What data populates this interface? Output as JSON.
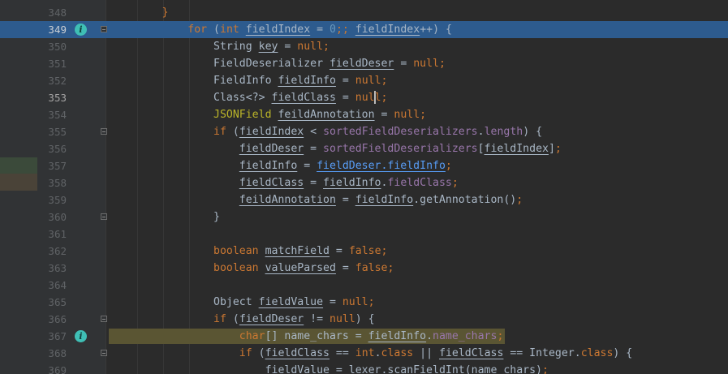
{
  "colors": {
    "kw": "#cc7832",
    "plain": "#a9b7c6",
    "field": "#9876aa",
    "num": "#6897bb",
    "method": "#ffc66d",
    "anno": "#bbb529",
    "link": "#589df6",
    "strip_green": "#3b4a3a",
    "strip_brown": "#4a4338"
  },
  "editor": {
    "lines": [
      {
        "n": "348",
        "segs": [
          {
            "t": "        ",
            "c": "plain"
          },
          {
            "t": "}",
            "c": "kw"
          }
        ]
      },
      {
        "n": "349",
        "info": true,
        "fold": true,
        "blue": true,
        "segs": [
          {
            "t": "            ",
            "c": "plain"
          },
          {
            "t": "for ",
            "c": "kw"
          },
          {
            "t": "(",
            "c": "plain"
          },
          {
            "t": "int ",
            "c": "kw"
          },
          {
            "t": "fieldIndex",
            "c": "plain",
            "u": true
          },
          {
            "t": " = ",
            "c": "plain"
          },
          {
            "t": "0",
            "c": "num"
          },
          {
            "t": ";; ",
            "c": "kw"
          },
          {
            "t": "fieldIndex",
            "c": "plain",
            "u": true
          },
          {
            "t": "++) {",
            "c": "plain"
          }
        ]
      },
      {
        "n": "350",
        "segs": [
          {
            "t": "                ",
            "c": "plain"
          },
          {
            "t": "String ",
            "c": "plain"
          },
          {
            "t": "key",
            "c": "plain",
            "u": true
          },
          {
            "t": " = ",
            "c": "plain"
          },
          {
            "t": "null",
            "c": "kw"
          },
          {
            "t": ";",
            "c": "kw"
          }
        ]
      },
      {
        "n": "351",
        "segs": [
          {
            "t": "                ",
            "c": "plain"
          },
          {
            "t": "FieldDeserializer ",
            "c": "plain"
          },
          {
            "t": "fieldDeser",
            "c": "plain",
            "u": true
          },
          {
            "t": " = ",
            "c": "plain"
          },
          {
            "t": "null",
            "c": "kw"
          },
          {
            "t": ";",
            "c": "kw"
          }
        ]
      },
      {
        "n": "352",
        "segs": [
          {
            "t": "                ",
            "c": "plain"
          },
          {
            "t": "FieldInfo ",
            "c": "plain"
          },
          {
            "t": "fieldInfo",
            "c": "plain",
            "u": true
          },
          {
            "t": " = ",
            "c": "plain"
          },
          {
            "t": "null",
            "c": "kw"
          },
          {
            "t": ";",
            "c": "kw"
          }
        ]
      },
      {
        "n": "353",
        "current": true,
        "segs": [
          {
            "t": "                ",
            "c": "plain"
          },
          {
            "t": "Class<?> ",
            "c": "plain"
          },
          {
            "t": "fieldClass",
            "c": "plain",
            "u": true
          },
          {
            "t": " = ",
            "c": "plain"
          },
          {
            "t": "nul",
            "c": "kw"
          },
          {
            "caret": true
          },
          {
            "t": "l",
            "c": "kw"
          },
          {
            "t": ";",
            "c": "kw"
          }
        ]
      },
      {
        "n": "354",
        "segs": [
          {
            "t": "                ",
            "c": "plain"
          },
          {
            "t": "JSONField ",
            "c": "anno"
          },
          {
            "t": "feildAnnotation",
            "c": "plain",
            "u": true
          },
          {
            "t": " = ",
            "c": "plain"
          },
          {
            "t": "null",
            "c": "kw"
          },
          {
            "t": ";",
            "c": "kw"
          }
        ]
      },
      {
        "n": "355",
        "fold": true,
        "segs": [
          {
            "t": "                ",
            "c": "plain"
          },
          {
            "t": "if ",
            "c": "kw"
          },
          {
            "t": "(",
            "c": "plain"
          },
          {
            "t": "fieldIndex",
            "c": "plain",
            "u": true
          },
          {
            "t": " < ",
            "c": "plain"
          },
          {
            "t": "sortedFieldDeserializers",
            "c": "field"
          },
          {
            "t": ".",
            "c": "plain"
          },
          {
            "t": "length",
            "c": "field"
          },
          {
            "t": ") {",
            "c": "plain"
          }
        ]
      },
      {
        "n": "356",
        "segs": [
          {
            "t": "                    ",
            "c": "plain"
          },
          {
            "t": "fieldDeser",
            "c": "plain",
            "u": true
          },
          {
            "t": " = ",
            "c": "plain"
          },
          {
            "t": "sortedFieldDeserializers",
            "c": "field"
          },
          {
            "t": "[",
            "c": "plain"
          },
          {
            "t": "fieldIndex",
            "c": "plain",
            "u": true
          },
          {
            "t": "]",
            "c": "plain"
          },
          {
            "t": ";",
            "c": "kw"
          }
        ]
      },
      {
        "n": "357",
        "segs": [
          {
            "t": "                    ",
            "c": "plain"
          },
          {
            "t": "fieldInfo",
            "c": "plain",
            "u": true
          },
          {
            "t": " = ",
            "c": "plain"
          },
          {
            "t": "fieldDeser.fieldInfo",
            "c": "link",
            "u": true
          },
          {
            "t": ";",
            "c": "kw"
          }
        ]
      },
      {
        "n": "358",
        "segs": [
          {
            "t": "                    ",
            "c": "plain"
          },
          {
            "t": "fieldClass",
            "c": "plain",
            "u": true
          },
          {
            "t": " = ",
            "c": "plain"
          },
          {
            "t": "fieldInfo",
            "c": "plain",
            "u": true
          },
          {
            "t": ".",
            "c": "plain"
          },
          {
            "t": "fieldClass",
            "c": "field"
          },
          {
            "t": ";",
            "c": "kw"
          }
        ]
      },
      {
        "n": "359",
        "segs": [
          {
            "t": "                    ",
            "c": "plain"
          },
          {
            "t": "feildAnnotation",
            "c": "plain",
            "u": true
          },
          {
            "t": " = ",
            "c": "plain"
          },
          {
            "t": "fieldInfo",
            "c": "plain",
            "u": true
          },
          {
            "t": ".getAnnotation()",
            "c": "plain"
          },
          {
            "t": ";",
            "c": "kw"
          }
        ]
      },
      {
        "n": "360",
        "fold": true,
        "segs": [
          {
            "t": "                ",
            "c": "plain"
          },
          {
            "t": "}",
            "c": "plain"
          }
        ]
      },
      {
        "n": "361",
        "segs": []
      },
      {
        "n": "362",
        "segs": [
          {
            "t": "                ",
            "c": "plain"
          },
          {
            "t": "boolean ",
            "c": "kw"
          },
          {
            "t": "matchField",
            "c": "plain",
            "u": true
          },
          {
            "t": " = ",
            "c": "plain"
          },
          {
            "t": "false",
            "c": "kw"
          },
          {
            "t": ";",
            "c": "kw"
          }
        ]
      },
      {
        "n": "363",
        "segs": [
          {
            "t": "                ",
            "c": "plain"
          },
          {
            "t": "boolean ",
            "c": "kw"
          },
          {
            "t": "valueParsed",
            "c": "plain",
            "u": true
          },
          {
            "t": " = ",
            "c": "plain"
          },
          {
            "t": "false",
            "c": "kw"
          },
          {
            "t": ";",
            "c": "kw"
          }
        ]
      },
      {
        "n": "364",
        "segs": []
      },
      {
        "n": "365",
        "segs": [
          {
            "t": "                ",
            "c": "plain"
          },
          {
            "t": "Object ",
            "c": "plain"
          },
          {
            "t": "fieldValue",
            "c": "plain",
            "u": true
          },
          {
            "t": " = ",
            "c": "plain"
          },
          {
            "t": "null",
            "c": "kw"
          },
          {
            "t": ";",
            "c": "kw"
          }
        ]
      },
      {
        "n": "366",
        "fold": true,
        "segs": [
          {
            "t": "                ",
            "c": "plain"
          },
          {
            "t": "if ",
            "c": "kw"
          },
          {
            "t": "(",
            "c": "plain"
          },
          {
            "t": "fieldDeser",
            "c": "plain",
            "u": true
          },
          {
            "t": " != ",
            "c": "plain"
          },
          {
            "t": "null",
            "c": "kw"
          },
          {
            "t": ") {",
            "c": "plain"
          }
        ]
      },
      {
        "n": "367",
        "info": true,
        "bp": true,
        "segs": [
          {
            "t": "                    ",
            "c": "plain"
          },
          {
            "t": "char",
            "c": "kw"
          },
          {
            "t": "[] name_chars = ",
            "c": "plain"
          },
          {
            "t": "fieldInfo",
            "c": "plain",
            "u": true
          },
          {
            "t": ".",
            "c": "plain"
          },
          {
            "t": "name_chars",
            "c": "field"
          },
          {
            "t": ";",
            "c": "kw"
          }
        ]
      },
      {
        "n": "368",
        "fold": true,
        "segs": [
          {
            "t": "                    ",
            "c": "plain"
          },
          {
            "t": "if ",
            "c": "kw"
          },
          {
            "t": "(",
            "c": "plain"
          },
          {
            "t": "fieldClass",
            "c": "plain",
            "u": true
          },
          {
            "t": " == ",
            "c": "plain"
          },
          {
            "t": "int",
            "c": "kw"
          },
          {
            "t": ".",
            "c": "plain"
          },
          {
            "t": "class ",
            "c": "kw"
          },
          {
            "t": "|| ",
            "c": "plain"
          },
          {
            "t": "fieldClass",
            "c": "plain",
            "u": true
          },
          {
            "t": " == Integer.",
            "c": "plain"
          },
          {
            "t": "class",
            "c": "kw"
          },
          {
            "t": ") {",
            "c": "plain"
          }
        ]
      },
      {
        "n": "369",
        "segs": [
          {
            "t": "                        ",
            "c": "plain"
          },
          {
            "t": "fieldValue",
            "c": "plain",
            "u": true
          },
          {
            "t": " = lexer.scanFieldInt(name_chars)",
            "c": "plain"
          },
          {
            "t": ";",
            "c": "kw"
          }
        ]
      }
    ]
  }
}
